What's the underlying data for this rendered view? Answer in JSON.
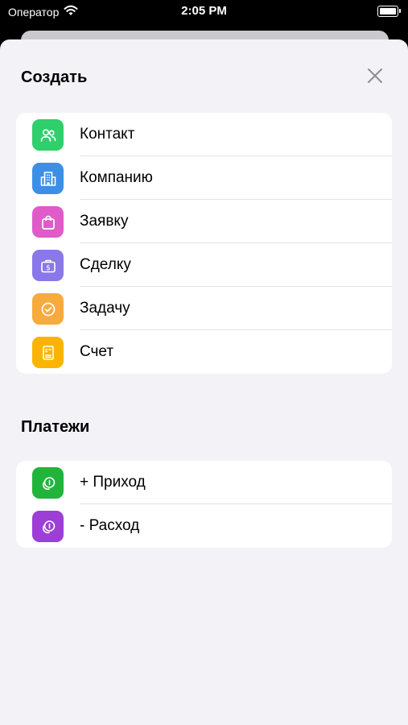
{
  "status_bar": {
    "carrier": "Оператор",
    "time": "2:05 PM"
  },
  "sheet": {
    "title": "Создать"
  },
  "create_items": [
    {
      "label": "Контакт",
      "icon": "contacts-icon",
      "color": "#2fcf6b"
    },
    {
      "label": "Компанию",
      "icon": "building-icon",
      "color": "#3d8fe6"
    },
    {
      "label": "Заявку",
      "icon": "bag-icon",
      "color": "#e05bc9"
    },
    {
      "label": "Сделку",
      "icon": "briefcase-dollar-icon",
      "color": "#8a78e8"
    },
    {
      "label": "Задачу",
      "icon": "check-circle-icon",
      "color": "#f7ab3c"
    },
    {
      "label": "Счет",
      "icon": "invoice-icon",
      "color": "#fbb400"
    }
  ],
  "payments": {
    "title": "Платежи",
    "items": [
      {
        "label": "+ Приход",
        "icon": "coins-icon",
        "color": "#21b43b"
      },
      {
        "label": "- Расход",
        "icon": "coins-icon",
        "color": "#9d3ed6"
      }
    ]
  }
}
